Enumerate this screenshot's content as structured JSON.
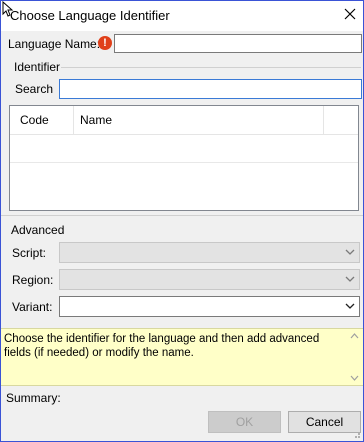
{
  "window": {
    "title": "Choose Language Identifier"
  },
  "language_name": {
    "label": "Language Name:",
    "value": "",
    "warning_icon": "error-exclamation-icon"
  },
  "identifier": {
    "group_label": "Identifier",
    "search_label": "Search",
    "search_value": "",
    "columns": [
      "Code",
      "Name"
    ]
  },
  "advanced": {
    "group_label": "Advanced",
    "script_label": "Script:",
    "script_value": "",
    "region_label": "Region:",
    "region_value": "",
    "variant_label": "Variant:",
    "variant_value": ""
  },
  "info": {
    "text": "Choose the identifier for the language and then add advanced fields (if needed) or modify the name."
  },
  "summary": {
    "label": "Summary:",
    "value": ""
  },
  "buttons": {
    "ok": "OK",
    "cancel": "Cancel"
  },
  "colors": {
    "window_border": "#3a53d6",
    "info_bg": "#ffffc8",
    "warning": "#e0401a"
  }
}
